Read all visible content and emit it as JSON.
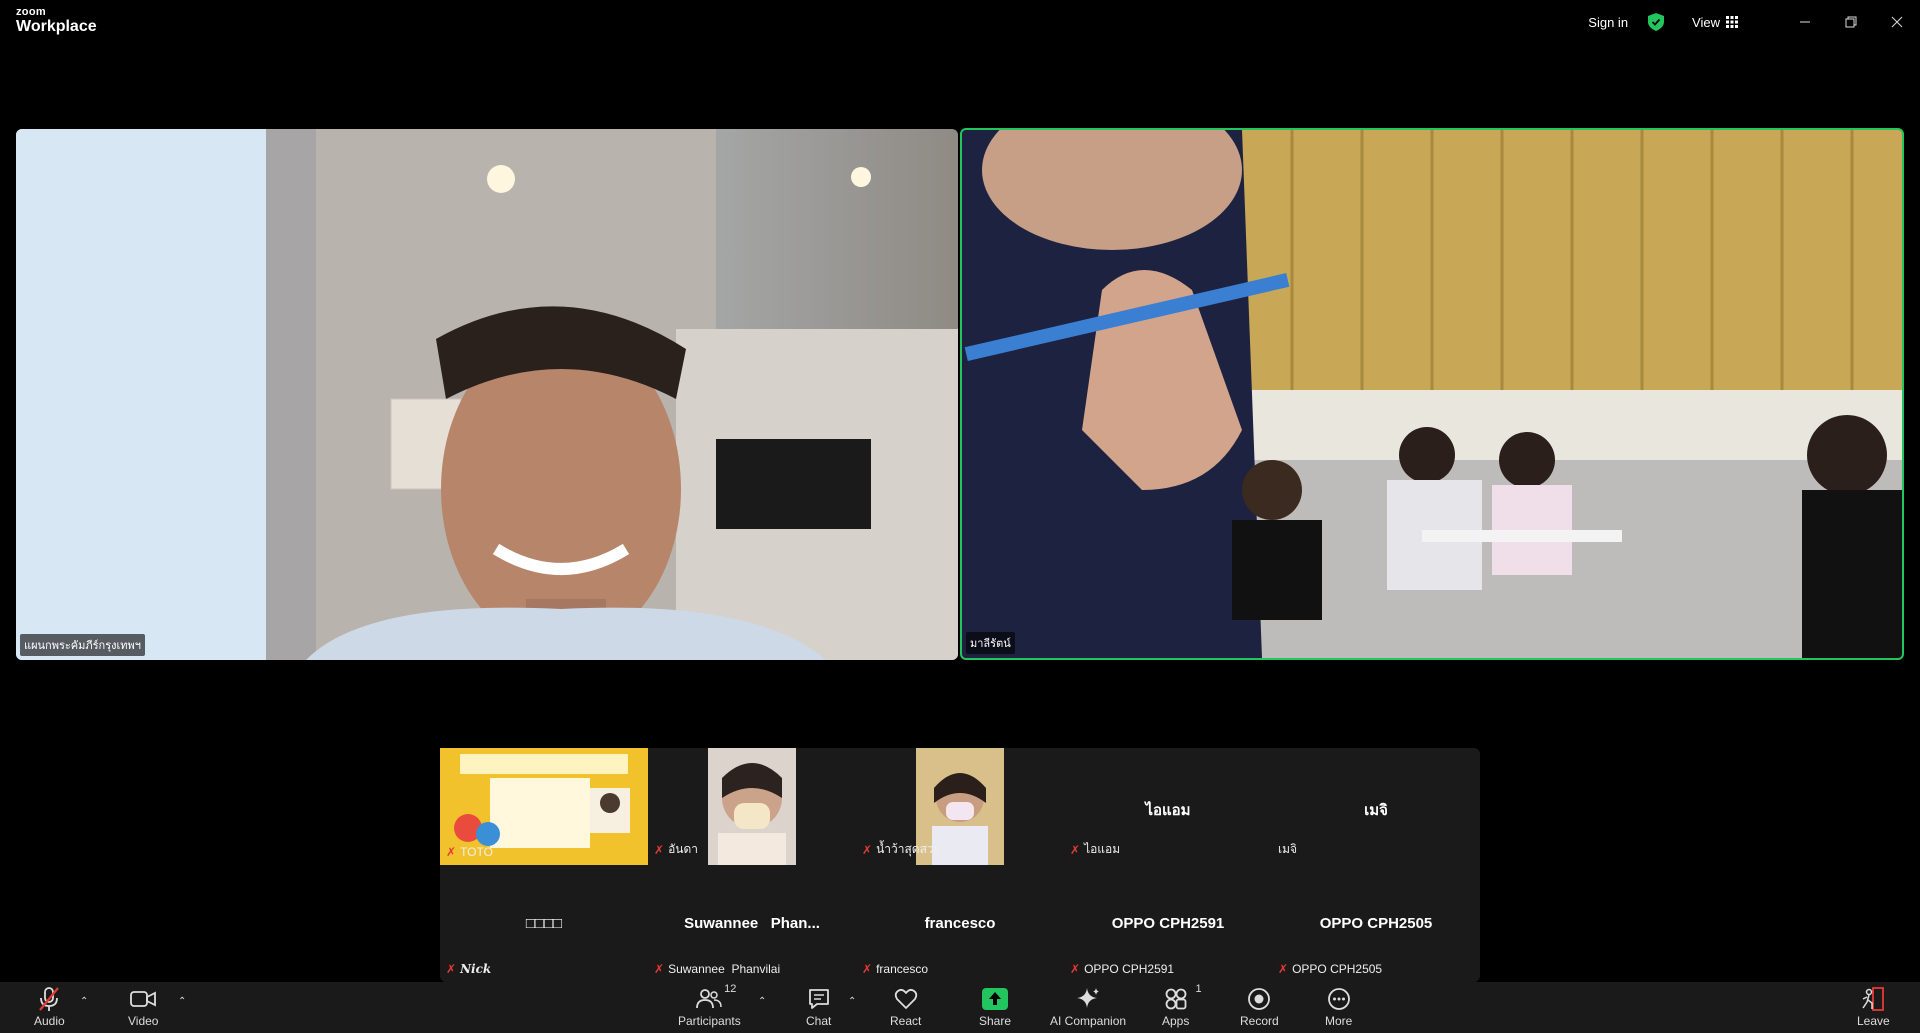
{
  "app": {
    "brand_small": "zoom",
    "brand_large": "Workplace"
  },
  "titlebar": {
    "sign_in": "Sign in",
    "view_label": "View"
  },
  "main_videos": [
    {
      "name": "แผนกพระคัมภีร์กรุงเทพฯ"
    },
    {
      "name": "มาลีรัตน์"
    }
  ],
  "gallery": [
    {
      "display": "",
      "tag": "TOTO"
    },
    {
      "display": "",
      "tag": "อันดา"
    },
    {
      "display": "",
      "tag": "น้ำว้าสุดสวย"
    },
    {
      "display": "ไอแอม",
      "tag": "ไอแอม"
    },
    {
      "display": "เมจิ",
      "tag": "เมจิ"
    },
    {
      "display": "□□□□",
      "tag": "Nick"
    },
    {
      "display": "Suwannee   Phan...",
      "tag": "Suwannee  Phanvilai"
    },
    {
      "display": "francesco",
      "tag": "francesco"
    },
    {
      "display": "OPPO CPH2591",
      "tag": "OPPO CPH2591"
    },
    {
      "display": "OPPO CPH2505",
      "tag": "OPPO CPH2505"
    }
  ],
  "toolbar": {
    "audio": "Audio",
    "video": "Video",
    "participants": "Participants",
    "participants_count": "12",
    "chat": "Chat",
    "react": "React",
    "share": "Share",
    "ai_companion": "AI Companion",
    "apps": "Apps",
    "apps_count": "1",
    "record": "Record",
    "more": "More",
    "leave": "Leave"
  },
  "colors": {
    "active_speaker": "#22c55e",
    "share": "#22c55e",
    "mic_off": "#e53935",
    "shield": "#22c55e"
  }
}
